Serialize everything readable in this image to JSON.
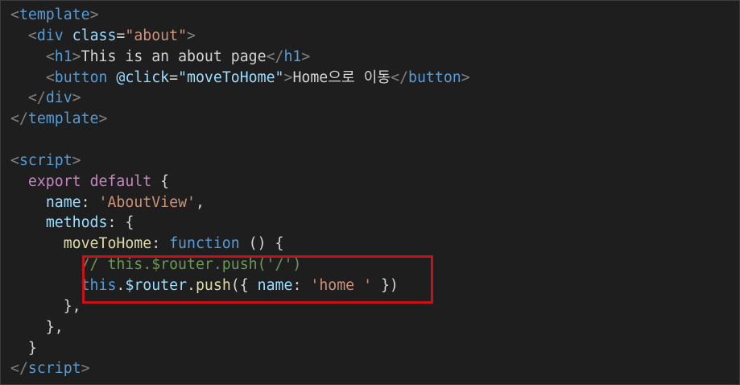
{
  "editor": {
    "lines": [
      [
        {
          "t": "<",
          "c": "punct"
        },
        {
          "t": "template",
          "c": "tag"
        },
        {
          "t": ">",
          "c": "punct"
        }
      ],
      [
        {
          "t": "  ",
          "c": "txt"
        },
        {
          "t": "<",
          "c": "punct"
        },
        {
          "t": "div",
          "c": "tag"
        },
        {
          "t": " ",
          "c": "txt"
        },
        {
          "t": "class",
          "c": "attr"
        },
        {
          "t": "=",
          "c": "txt"
        },
        {
          "t": "\"about\"",
          "c": "str"
        },
        {
          "t": ">",
          "c": "punct"
        }
      ],
      [
        {
          "t": "    ",
          "c": "txt"
        },
        {
          "t": "<",
          "c": "punct"
        },
        {
          "t": "h1",
          "c": "tag"
        },
        {
          "t": ">",
          "c": "punct"
        },
        {
          "t": "This is an about page",
          "c": "txt"
        },
        {
          "t": "</",
          "c": "punct"
        },
        {
          "t": "h1",
          "c": "tag"
        },
        {
          "t": ">",
          "c": "punct"
        }
      ],
      [
        {
          "t": "    ",
          "c": "txt"
        },
        {
          "t": "<",
          "c": "punct"
        },
        {
          "t": "button",
          "c": "tag"
        },
        {
          "t": " ",
          "c": "txt"
        },
        {
          "t": "@click",
          "c": "attr"
        },
        {
          "t": "=",
          "c": "txt"
        },
        {
          "t": "\"moveToHome\"",
          "c": "attr"
        },
        {
          "t": ">",
          "c": "punct"
        },
        {
          "t": "Home으로 이동",
          "c": "txt"
        },
        {
          "t": "</",
          "c": "punct"
        },
        {
          "t": "button",
          "c": "tag"
        },
        {
          "t": ">",
          "c": "punct"
        }
      ],
      [
        {
          "t": "  ",
          "c": "txt"
        },
        {
          "t": "</",
          "c": "punct"
        },
        {
          "t": "div",
          "c": "tag"
        },
        {
          "t": ">",
          "c": "punct"
        }
      ],
      [
        {
          "t": "</",
          "c": "punct"
        },
        {
          "t": "template",
          "c": "tag"
        },
        {
          "t": ">",
          "c": "punct"
        }
      ],
      [],
      [
        {
          "t": "<",
          "c": "punct"
        },
        {
          "t": "script",
          "c": "tag"
        },
        {
          "t": ">",
          "c": "punct"
        }
      ],
      [
        {
          "t": "  ",
          "c": "txt"
        },
        {
          "t": "export",
          "c": "kw"
        },
        {
          "t": " ",
          "c": "txt"
        },
        {
          "t": "default",
          "c": "kw"
        },
        {
          "t": " {",
          "c": "txt"
        }
      ],
      [
        {
          "t": "    ",
          "c": "txt"
        },
        {
          "t": "name",
          "c": "var"
        },
        {
          "t": ": ",
          "c": "txt"
        },
        {
          "t": "'AboutView'",
          "c": "str"
        },
        {
          "t": ",",
          "c": "txt"
        }
      ],
      [
        {
          "t": "    ",
          "c": "txt"
        },
        {
          "t": "methods",
          "c": "var"
        },
        {
          "t": ": {",
          "c": "txt"
        }
      ],
      [
        {
          "t": "      ",
          "c": "txt"
        },
        {
          "t": "moveToHome",
          "c": "fn"
        },
        {
          "t": ": ",
          "c": "txt"
        },
        {
          "t": "function",
          "c": "storage"
        },
        {
          "t": " () {",
          "c": "txt"
        }
      ],
      [
        {
          "t": "        ",
          "c": "txt"
        },
        {
          "t": "// this.$router.push('/')",
          "c": "comment"
        }
      ],
      [
        {
          "t": "        ",
          "c": "txt"
        },
        {
          "t": "this",
          "c": "storage"
        },
        {
          "t": ".",
          "c": "txt"
        },
        {
          "t": "$router",
          "c": "var"
        },
        {
          "t": ".",
          "c": "txt"
        },
        {
          "t": "push",
          "c": "fn"
        },
        {
          "t": "({ ",
          "c": "txt"
        },
        {
          "t": "name",
          "c": "var"
        },
        {
          "t": ": ",
          "c": "txt"
        },
        {
          "t": "'home '",
          "c": "str"
        },
        {
          "t": " })",
          "c": "txt"
        }
      ],
      [
        {
          "t": "      },",
          "c": "txt"
        }
      ],
      [
        {
          "t": "    },",
          "c": "txt"
        }
      ],
      [
        {
          "t": "  }",
          "c": "txt"
        }
      ],
      [
        {
          "t": "</",
          "c": "punct"
        },
        {
          "t": "script",
          "c": "tag"
        },
        {
          "t": ">",
          "c": "punct"
        }
      ]
    ]
  },
  "colors": {
    "background": "#1e1e1e",
    "highlight_border": "#c8121a"
  }
}
